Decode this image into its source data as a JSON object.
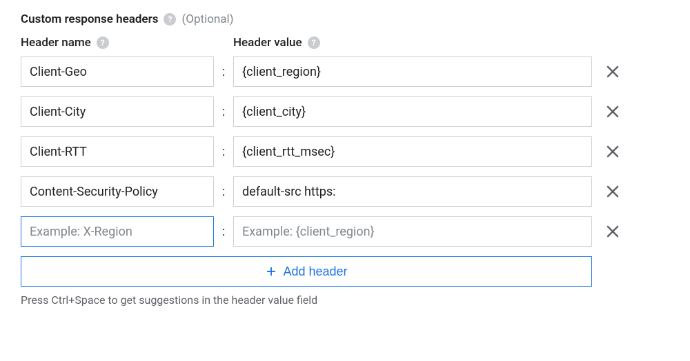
{
  "section": {
    "title": "Custom response headers",
    "optional": "(Optional)"
  },
  "columns": {
    "name": "Header name",
    "value": "Header value"
  },
  "placeholders": {
    "name": "Example: X-Region",
    "value": "Example: {client_region}"
  },
  "rows": [
    {
      "name": "Client-Geo",
      "value": "{client_region}",
      "focused": false
    },
    {
      "name": "Client-City",
      "value": "{client_city}",
      "focused": false
    },
    {
      "name": "Client-RTT",
      "value": "{client_rtt_msec}",
      "focused": false
    },
    {
      "name": "Content-Security-Policy",
      "value": "default-src https:",
      "focused": false
    },
    {
      "name": "",
      "value": "",
      "focused": true
    }
  ],
  "colon": ":",
  "addButton": "Add header",
  "hint": "Press Ctrl+Space to get suggestions in the header value field"
}
